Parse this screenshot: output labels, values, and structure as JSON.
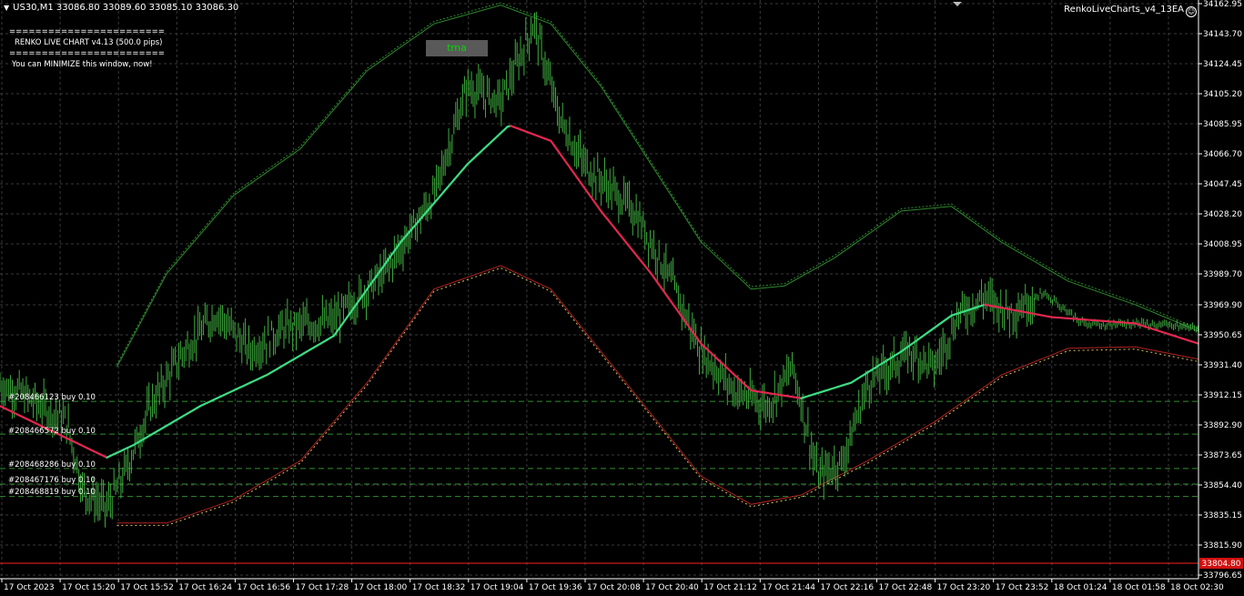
{
  "header": {
    "symbol_line": "US30,M1  33086.80 33089.60 33085.10 33086.30",
    "ea_name": "RenkoLiveCharts_v4_13EA",
    "ea_icon": "smiley-icon"
  },
  "comment": {
    "line1": "========================",
    "line2": "RENKO LIVE CHART v4.13 (500.0 pips)",
    "line3": "========================",
    "line4": "You can MINIMIZE this window, now!"
  },
  "tma_button": "tma",
  "orders": [
    {
      "label": "#208466123 buy 0.10",
      "price": 33908
    },
    {
      "label": "#208466572 buy 0.10",
      "price": 33887
    },
    {
      "label": "#208468286 buy 0.10",
      "price": 33865
    },
    {
      "label": "#208467176 buy 0.10",
      "price": 33855
    },
    {
      "label": "#208468819 buy 0.10",
      "price": 33847
    }
  ],
  "price_axis": [
    "34162.95",
    "34143.70",
    "34124.45",
    "34105.20",
    "34085.95",
    "34066.70",
    "34047.45",
    "34028.20",
    "34008.95",
    "33989.70",
    "33969.90",
    "33950.65",
    "33931.40",
    "33912.15",
    "33892.90",
    "33873.65",
    "33854.40",
    "33835.15",
    "33815.90",
    "33796.65"
  ],
  "current_price_tag": "33804.80",
  "time_axis": [
    "17 Oct 2023",
    "17 Oct 15:20",
    "17 Oct 15:52",
    "17 Oct 16:24",
    "17 Oct 16:56",
    "17 Oct 17:28",
    "17 Oct 18:00",
    "17 Oct 18:32",
    "17 Oct 19:04",
    "17 Oct 19:36",
    "17 Oct 20:08",
    "17 Oct 20:40",
    "17 Oct 21:12",
    "17 Oct 21:44",
    "17 Oct 22:16",
    "17 Oct 22:48",
    "17 Oct 23:20",
    "17 Oct 23:52",
    "18 Oct 01:24",
    "18 Oct 01:58",
    "18 Oct 02:30"
  ],
  "colors": {
    "background": "#000000",
    "grid": "#3a3a3a",
    "bars": "#3fae3f",
    "tma_up": "#3ddc84",
    "tma_down": "#e0284f",
    "upper_band": "#2e8b2e",
    "lower_band": "#b22222",
    "order_line": "#2f8f2f",
    "price_line": "#ff2020",
    "axis_text": "#ffffff"
  },
  "chart_data": {
    "type": "candlestick",
    "ylim": [
      33796.65,
      34162.95
    ],
    "x_range_minutes": [
      0,
      718
    ],
    "close_path": [
      [
        0,
        33918
      ],
      [
        10,
        33915
      ],
      [
        20,
        33908
      ],
      [
        40,
        33895
      ],
      [
        50,
        33850
      ],
      [
        64,
        33840
      ],
      [
        74,
        33860
      ],
      [
        90,
        33905
      ],
      [
        110,
        33940
      ],
      [
        130,
        33965
      ],
      [
        150,
        33940
      ],
      [
        170,
        33955
      ],
      [
        200,
        33960
      ],
      [
        230,
        33990
      ],
      [
        260,
        34040
      ],
      [
        280,
        34110
      ],
      [
        300,
        34100
      ],
      [
        320,
        34150
      ],
      [
        335,
        34090
      ],
      [
        350,
        34060
      ],
      [
        380,
        34030
      ],
      [
        400,
        33990
      ],
      [
        420,
        33940
      ],
      [
        440,
        33915
      ],
      [
        460,
        33905
      ],
      [
        475,
        33930
      ],
      [
        490,
        33860
      ],
      [
        505,
        33870
      ],
      [
        520,
        33920
      ],
      [
        545,
        33940
      ],
      [
        560,
        33930
      ],
      [
        575,
        33965
      ],
      [
        590,
        33975
      ],
      [
        605,
        33965
      ],
      [
        625,
        33978
      ],
      [
        650,
        33957
      ],
      [
        680,
        33958
      ],
      [
        718,
        33955
      ]
    ],
    "tma_center": [
      [
        0,
        33905
      ],
      [
        64,
        33872
      ],
      [
        80,
        33880
      ],
      [
        120,
        33905
      ],
      [
        160,
        33925
      ],
      [
        200,
        33950
      ],
      [
        240,
        34010
      ],
      [
        280,
        34060
      ],
      [
        305,
        34085
      ],
      [
        330,
        34075
      ],
      [
        360,
        34030
      ],
      [
        390,
        33990
      ],
      [
        420,
        33945
      ],
      [
        450,
        33915
      ],
      [
        480,
        33910
      ],
      [
        510,
        33920
      ],
      [
        540,
        33940
      ],
      [
        570,
        33963
      ],
      [
        590,
        33970
      ],
      [
        630,
        33962
      ],
      [
        680,
        33958
      ],
      [
        718,
        33945
      ]
    ],
    "upper_band": [
      [
        70,
        33930
      ],
      [
        100,
        33990
      ],
      [
        140,
        34040
      ],
      [
        180,
        34070
      ],
      [
        220,
        34120
      ],
      [
        260,
        34150
      ],
      [
        300,
        34162
      ],
      [
        330,
        34150
      ],
      [
        360,
        34110
      ],
      [
        390,
        34060
      ],
      [
        420,
        34010
      ],
      [
        450,
        33980
      ],
      [
        470,
        33982
      ],
      [
        500,
        34000
      ],
      [
        540,
        34030
      ],
      [
        570,
        34033
      ],
      [
        600,
        34010
      ],
      [
        640,
        33985
      ],
      [
        680,
        33970
      ],
      [
        718,
        33953
      ]
    ],
    "lower_band": [
      [
        70,
        33830
      ],
      [
        100,
        33830
      ],
      [
        140,
        33845
      ],
      [
        180,
        33870
      ],
      [
        220,
        33920
      ],
      [
        260,
        33980
      ],
      [
        300,
        33995
      ],
      [
        330,
        33980
      ],
      [
        360,
        33940
      ],
      [
        390,
        33900
      ],
      [
        420,
        33860
      ],
      [
        450,
        33842
      ],
      [
        480,
        33848
      ],
      [
        520,
        33870
      ],
      [
        560,
        33895
      ],
      [
        600,
        33925
      ],
      [
        640,
        33942
      ],
      [
        680,
        33943
      ],
      [
        718,
        33935
      ]
    ]
  }
}
